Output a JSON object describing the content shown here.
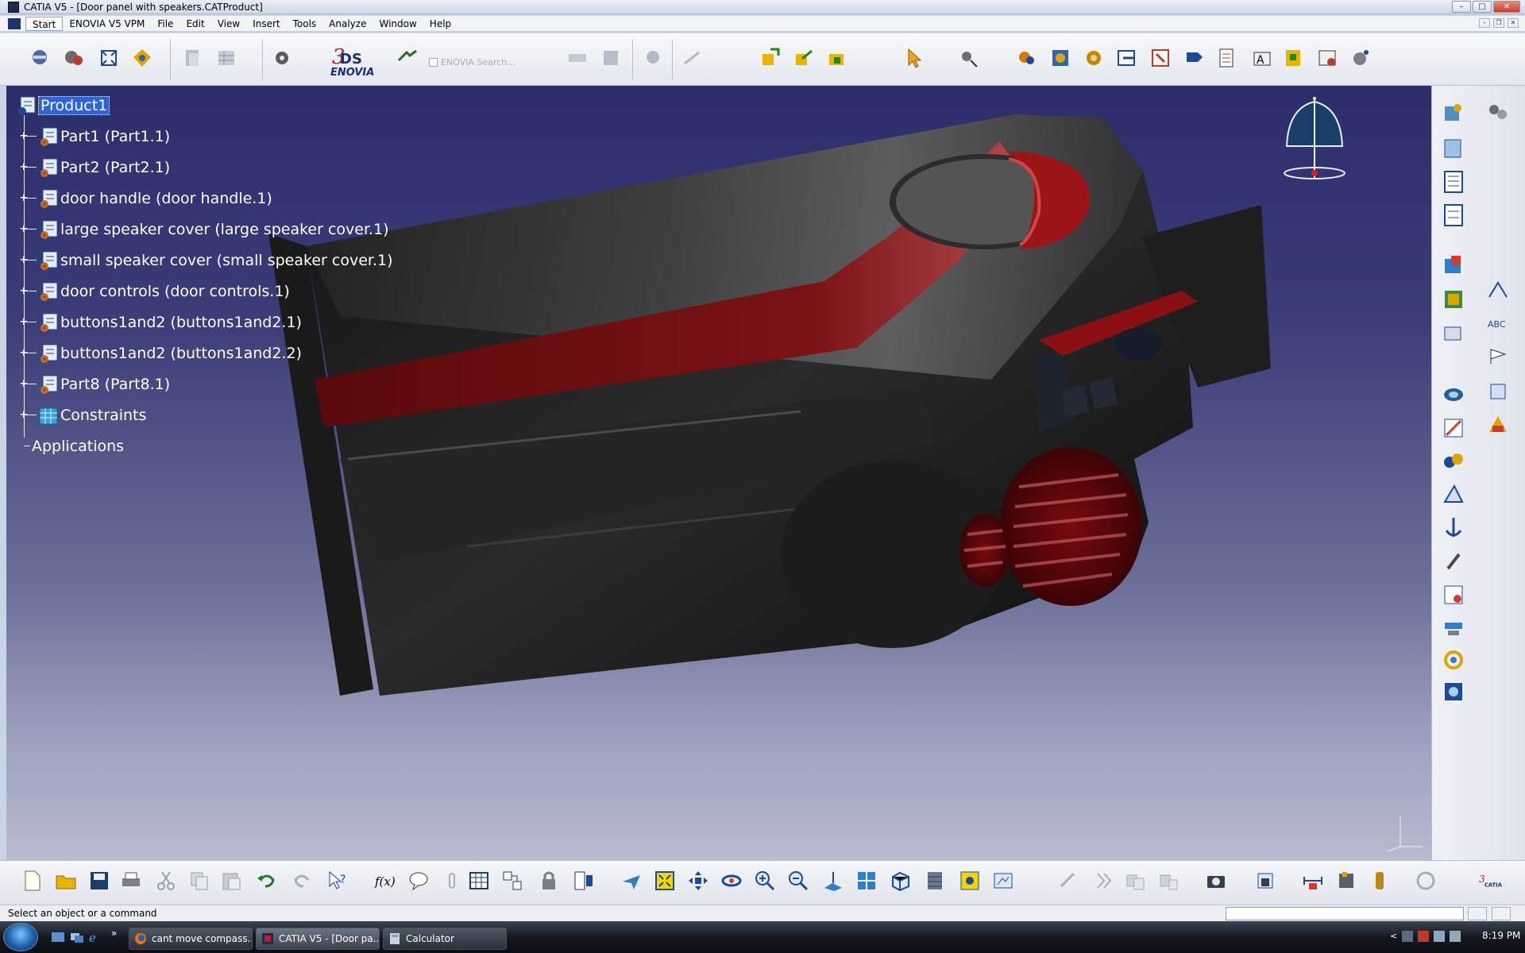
{
  "window": {
    "title": "CATIA V5 - [Door panel with speakers.CATProduct]"
  },
  "menu": {
    "items": [
      "Start",
      "ENOVIA V5 VPM",
      "File",
      "Edit",
      "View",
      "Insert",
      "Tools",
      "Analyze",
      "Window",
      "Help"
    ]
  },
  "toolbar": {
    "enovia_logo_text": "ENOVIA",
    "enovia_search_placeholder": "ENOVIA Search..."
  },
  "tree": {
    "root": "Product1",
    "children": [
      "Part1 (Part1.1)",
      "Part2 (Part2.1)",
      "door handle (door handle.1)",
      "large speaker cover (large speaker cover.1)",
      "small speaker cover (small speaker cover.1)",
      "door controls (door controls.1)",
      "buttons1and2 (buttons1and2.1)",
      "buttons1and2 (buttons1and2.2)",
      "Part8 (Part8.1)",
      "Constraints"
    ],
    "applications": "Applications"
  },
  "status": {
    "message": "Select an object or a command"
  },
  "taskbar": {
    "buttons": [
      "cant move compass...",
      "CATIA V5 - [Door pa...",
      "Calculator"
    ],
    "clock": "8:19 PM"
  },
  "colors": {
    "viewport_top": "#2b2e6b",
    "viewport_bottom": "#b8bad0",
    "selection": "#2f63d8",
    "accent_red": "#8a0f12"
  }
}
